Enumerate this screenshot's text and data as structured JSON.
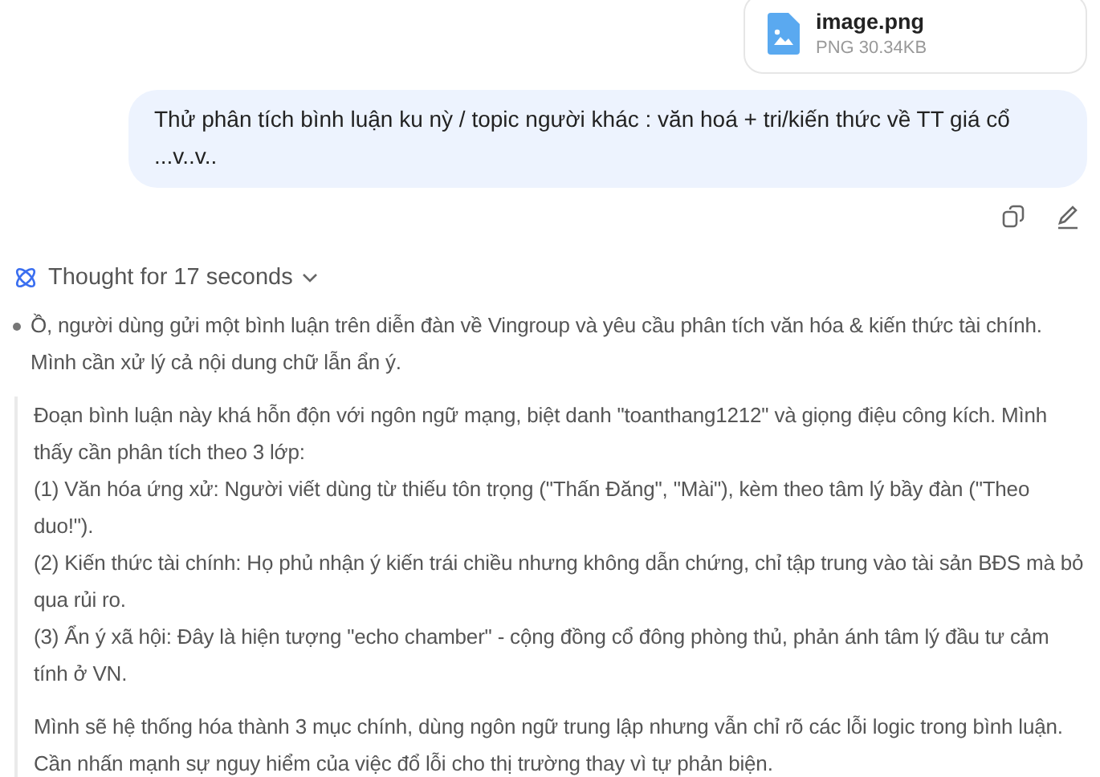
{
  "attachment": {
    "name": "image.png",
    "meta": "PNG 30.34KB"
  },
  "user_message": "Thử phân tích bình luận ku nỳ / topic người khác : văn hoá + tri/kiến thức về TT giá cổ ...v..v..",
  "thought": {
    "label": "Thought for 17 seconds",
    "expanded": true,
    "blocks": [
      {
        "kind": "bullet",
        "text": "Ồ, người dùng gửi một bình luận trên diễn đàn về Vingroup và yêu cầu phân tích văn hóa & kiến thức tài chính. Mình cần xử lý cả nội dung chữ lẫn ẩn ý."
      },
      {
        "kind": "para",
        "lines": [
          "Đoạn bình luận này khá hỗn độn với ngôn ngữ mạng, biệt danh \"toanthang1212\" và giọng điệu công kích. Mình thấy cần phân tích theo 3 lớp:",
          "(1) Văn hóa ứng xử: Người viết dùng từ thiếu tôn trọng (\"Thấn Đăng\", \"Mài\"), kèm theo tâm lý bầy đàn (\"Theo duo!\").",
          "(2) Kiến thức tài chính: Họ phủ nhận ý kiến trái chiều nhưng không dẫn chứng, chỉ tập trung vào tài sản BĐS mà bỏ qua rủi ro.",
          "(3) Ẩn ý xã hội: Đây là hiện tượng \"echo chamber\" - cộng đồng cổ đông phòng thủ, phản ánh tâm lý đầu tư cảm tính ở VN."
        ]
      },
      {
        "kind": "para",
        "lines": [
          "Mình sẽ hệ thống hóa thành 3 mục chính, dùng ngôn ngữ trung lập nhưng vẫn chỉ rõ các lỗi logic trong bình luận. Cần nhấn mạnh sự nguy hiểm của việc đổ lỗi cho thị trường thay vì tự phản biện."
        ]
      }
    ]
  }
}
